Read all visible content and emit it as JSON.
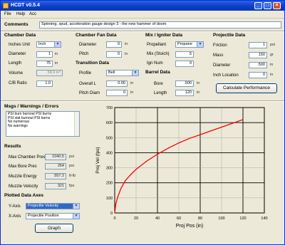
{
  "window": {
    "title": "HCDT v0.5.4"
  },
  "menu": [
    "File",
    "Help",
    "Acc"
  ],
  "comments": {
    "label": "Comments",
    "value": "Spinning, spud, acceleration gauge design 3 - the new hammer of doom"
  },
  "chamber": {
    "header": "Chamber Data",
    "fields": [
      {
        "label": "Inches Unit",
        "value": "Inch",
        "unit": "",
        "type": "select"
      },
      {
        "label": "Diameter",
        "value": "1",
        "unit": "in"
      },
      {
        "label": "Length",
        "value": "75",
        "unit": "in"
      },
      {
        "label": "Volume",
        "value": "58.9 in³",
        "unit": "",
        "disabled": true
      },
      {
        "label": "C/B Ratio",
        "value": "1.0",
        "unit": ""
      }
    ]
  },
  "chamber_fan": {
    "header": "Chamber Fan Data",
    "fields": [
      {
        "label": "Diameter",
        "value": "0",
        "unit": "in"
      },
      {
        "label": "Pitch",
        "value": "0",
        "unit": "in"
      }
    ]
  },
  "transition": {
    "header": "Transition Data",
    "style_label": "Profile",
    "style_value": "Bell",
    "fields": [
      {
        "label": "Overall L",
        "value": "0.00",
        "unit": "in"
      },
      {
        "label": "Pitch Diam",
        "value": "0",
        "unit": "in"
      }
    ]
  },
  "mix": {
    "header": "Mix / Igniter Data",
    "fields": [
      {
        "label": "Propellant",
        "value": "Propane",
        "unit": "",
        "type": "select"
      },
      {
        "label": "Mix (Stoich)",
        "value": "5",
        "unit": ""
      },
      {
        "label": "Ign Num",
        "value": "0",
        "unit": ""
      }
    ]
  },
  "barrel": {
    "header": "Barrel Data",
    "fields": [
      {
        "label": "Bore",
        "value": ".500",
        "unit": "in"
      },
      {
        "label": "Length",
        "value": "120",
        "unit": "in"
      }
    ]
  },
  "projectile": {
    "header": "Projectile Data",
    "fields": [
      {
        "label": "Friction",
        "value": "1",
        "unit": "psi"
      },
      {
        "label": "Mass",
        "value": "150",
        "unit": "gr"
      },
      {
        "label": "Diameter",
        "value": ".500",
        "unit": "in"
      },
      {
        "label": "Inch Location",
        "value": "0",
        "unit": "in"
      }
    ],
    "calc_button": "Calculate Performance"
  },
  "messages": {
    "header": "Msgs / Warnings / Errors",
    "lines": [
      "PSI burn burnout PSI burns",
      "PSI stat burnout PSI burns",
      "No numerous",
      "No warnings"
    ]
  },
  "results": {
    "header": "Results",
    "fields": [
      {
        "label": "Max Chamber Pres",
        "value": "1040.5",
        "unit": "psi"
      },
      {
        "label": "Max Bore Pres",
        "value": "264",
        "unit": "psi"
      },
      {
        "label": "Muzzle Energy",
        "value": "557.2",
        "unit": "ft-lb"
      },
      {
        "label": "Muzzle Velocity",
        "value": "321",
        "unit": "fps"
      }
    ]
  },
  "plotted": {
    "header": "Plotted Data Axes",
    "y_label": "Y-Axis",
    "y_value": "Projectile Velocity",
    "x_label": "X-Axis",
    "x_value": "Projectile Position",
    "button": "Graph"
  },
  "chart_data": {
    "type": "line",
    "xlabel": "Proj Pos (in)",
    "ylabel": "Proj Vel (fps)",
    "xlim": [
      0,
      140
    ],
    "ylim": [
      0,
      700
    ],
    "x_ticks": [
      "0",
      "20",
      "40",
      "60",
      "80",
      "100",
      "120",
      "140"
    ],
    "y_ticks": [
      "0",
      "100",
      "200",
      "300",
      "400",
      "500",
      "600",
      "700"
    ],
    "grid": true,
    "line_color": "#ff0000",
    "series": [
      {
        "x": [
          0,
          1,
          3,
          6,
          10,
          15,
          20,
          30,
          40,
          50,
          60,
          70,
          80,
          90,
          100,
          110,
          120
        ],
        "values": [
          0,
          60,
          110,
          165,
          215,
          255,
          290,
          345,
          390,
          430,
          465,
          495,
          520,
          545,
          570,
          595,
          620
        ]
      }
    ]
  }
}
